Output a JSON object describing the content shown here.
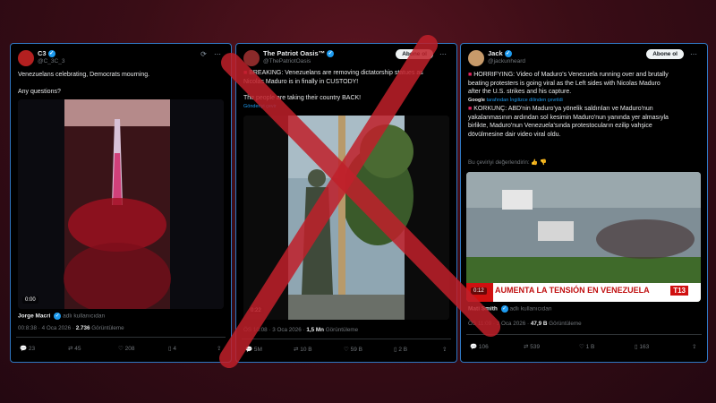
{
  "colors": {
    "accent": "#1d9bf0",
    "card_border": "#2f77c2",
    "cross": "#c0202a"
  },
  "cards": [
    {
      "name": "C3",
      "handle": "@C_3C_3",
      "text_lines": [
        "Venezuelans celebrating, Democrats mourning.",
        "",
        "Any questions?"
      ],
      "video_time": "0:00",
      "user_name": "Jorge Macri",
      "user_tail": "adlı kullanıcıdan",
      "meta_time": "00:8:38 · 4 Oca 2026 · ",
      "meta_views": "2.736",
      "meta_views_label": " Görüntüleme",
      "actions": [
        "23",
        "45",
        "208",
        "4"
      ]
    },
    {
      "name": "The Patriot Oasis™",
      "handle": "@ThePatriotOasis",
      "follow": "Abone ol",
      "text_lines": [
        "BREAKING: Venezuelans are removing dictatorship statues as",
        "Nicolas Maduro is in finally in CUSTODY!",
        "",
        "The people are taking their country BACK!"
      ],
      "translate": "Gönderiyi çevir",
      "video_time": "0:22",
      "meta_time": "ÖS 10:08 · 3 Oca 2026 · ",
      "meta_views": "1,5 Mn",
      "meta_views_label": " Görüntüleme",
      "actions": [
        "5M",
        "10 B",
        "59 B",
        "2 B"
      ]
    },
    {
      "name": "Jack",
      "handle": "@jackunheard",
      "follow": "Abone ol",
      "text_lines": [
        "HORRIFYING: Video of Maduro's Venezuela running over and brutally",
        "beating protesters is going viral as the Left sides with Nicolas Maduro",
        "after the U.S. strikes and his capture."
      ],
      "google": "Google",
      "google_note": "tarafından İngilizce dilinden çevrildi",
      "tr_lines": [
        "KORKUNÇ: ABD'nin Maduro'ya yönelik saldırıları ve Maduro'nun",
        "yakalanmasının ardından sol kesimin Maduro'nun yanında yer almasıyla",
        "birlikte, Maduro'nun Venezuela'sında protestocuların ezilip vahşice",
        "dövülmesine dair video viral oldu."
      ],
      "rate": "Bu çeviriyi değerlendirin:",
      "banner": "AUMENTA LA TENSIÓN EN VENEZUELA",
      "channel": "T13",
      "video_time": "0:12",
      "user_name": "Mati Smith",
      "user_tail": "adlı kullanıcıdan",
      "meta_time": "ÖS 11:09 · 3 Oca 2026 · ",
      "meta_views": "47,9 B",
      "meta_views_label": " Görüntüleme",
      "actions": [
        "106",
        "539",
        "1 B",
        "163"
      ]
    }
  ]
}
